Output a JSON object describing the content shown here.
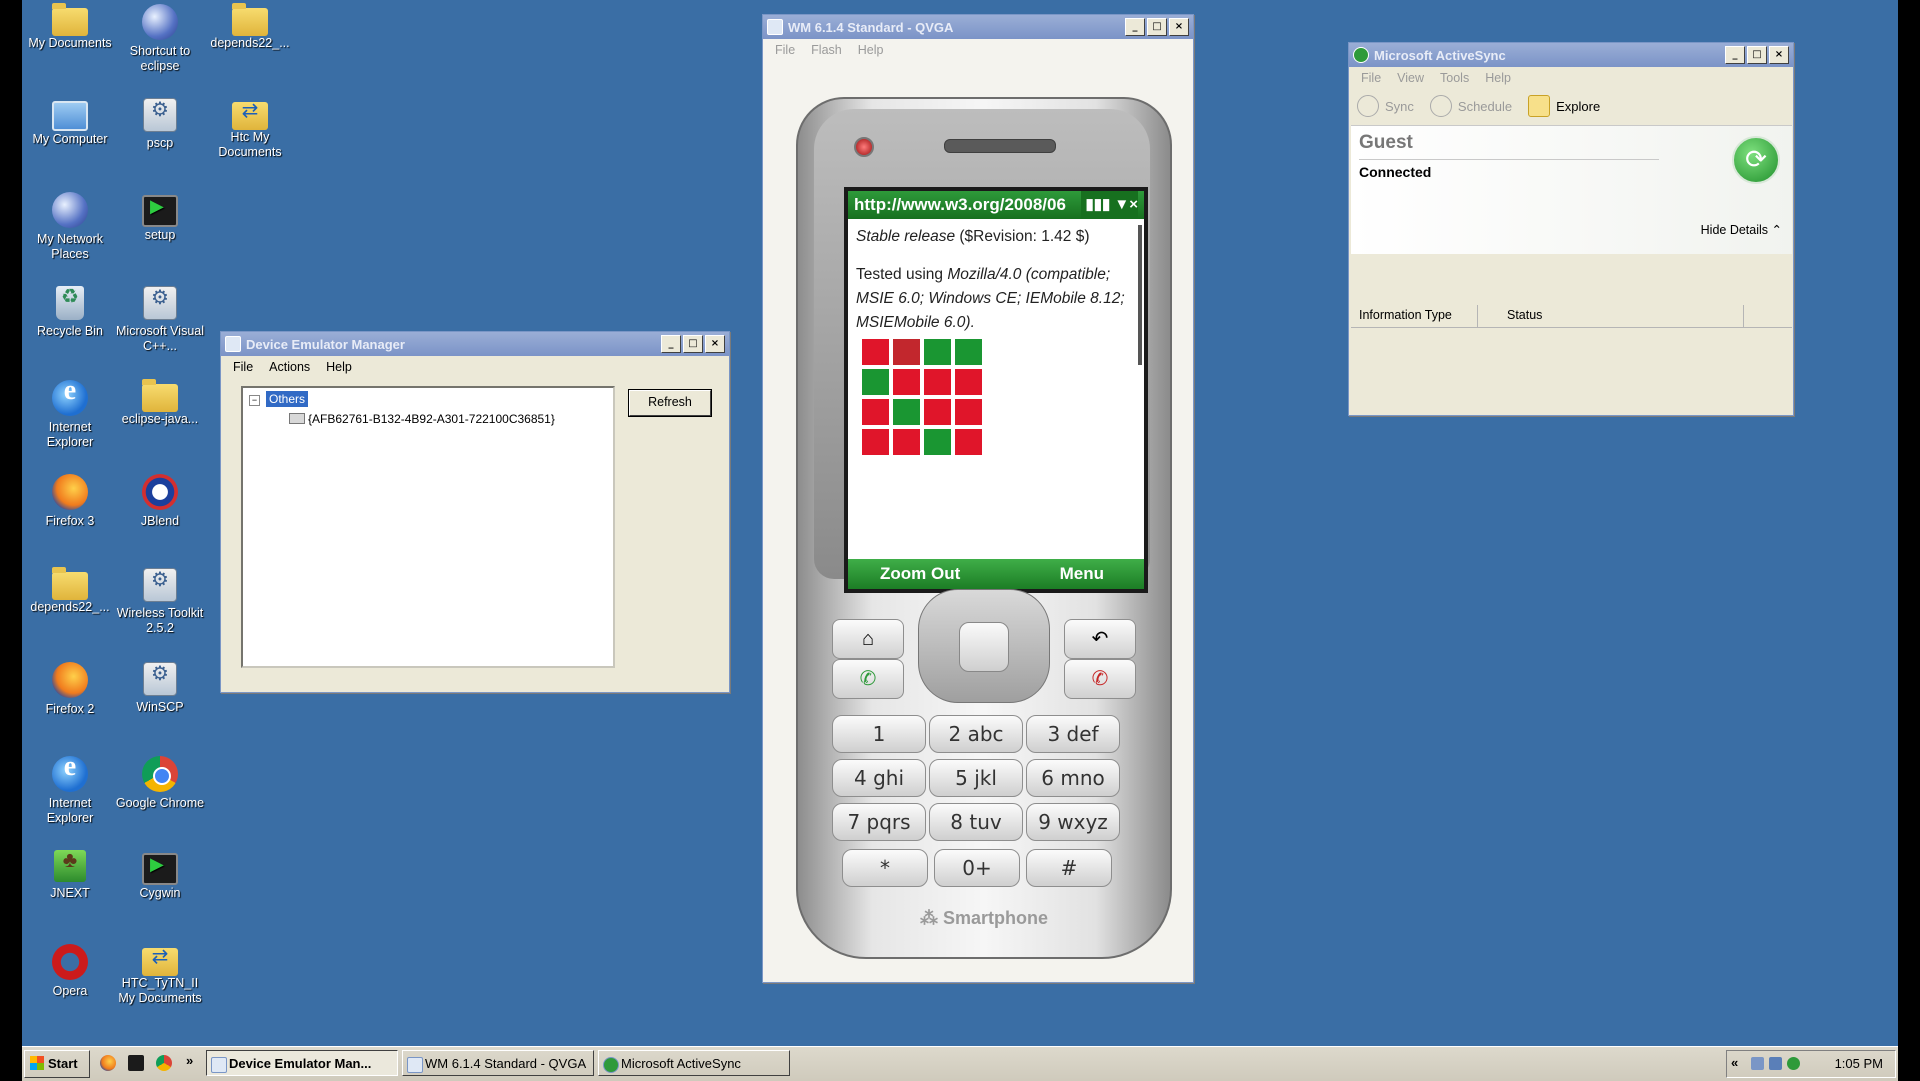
{
  "desktop_icons": [
    {
      "label": "My Documents",
      "icon": "folder-documents-icon"
    },
    {
      "label": "Shortcut to eclipse",
      "icon": "eclipse-icon"
    },
    {
      "label": "depends22_...",
      "icon": "folder-icon"
    },
    {
      "label": "My Computer",
      "icon": "my-computer-icon"
    },
    {
      "label": "pscp",
      "icon": "pscp-icon"
    },
    {
      "label": "Htc My Documents",
      "icon": "htc-sync-folder-icon"
    },
    {
      "label": "My Network Places",
      "icon": "network-places-icon"
    },
    {
      "label": "setup",
      "icon": "setup-icon"
    },
    {
      "label": "Recycle Bin",
      "icon": "recycle-bin-icon"
    },
    {
      "label": "Microsoft Visual C++...",
      "icon": "visual-cpp-icon"
    },
    {
      "label": "Internet Explorer",
      "icon": "internet-explorer-icon"
    },
    {
      "label": "eclipse-java...",
      "icon": "folder-icon"
    },
    {
      "label": "Firefox 3",
      "icon": "firefox-icon"
    },
    {
      "label": "JBlend",
      "icon": "jblend-icon"
    },
    {
      "label": "depends22_...",
      "icon": "folder-icon"
    },
    {
      "label": "Wireless Toolkit 2.5.2",
      "icon": "wireless-toolkit-icon"
    },
    {
      "label": "Firefox 2",
      "icon": "firefox-icon"
    },
    {
      "label": "WinSCP",
      "icon": "winscp-icon"
    },
    {
      "label": "Internet Explorer",
      "icon": "internet-explorer-icon"
    },
    {
      "label": "Google Chrome",
      "icon": "chrome-icon"
    },
    {
      "label": "JNEXT",
      "icon": "jnext-icon"
    },
    {
      "label": "Cygwin",
      "icon": "cygwin-icon"
    },
    {
      "label": "Opera",
      "icon": "opera-icon"
    },
    {
      "label": "HTC_TyTN_II My Documents",
      "icon": "htc-sync-folder-icon"
    }
  ],
  "dem": {
    "title": "Device Emulator Manager",
    "menu": [
      "File",
      "Actions",
      "Help"
    ],
    "tree_root": "Others",
    "tree_child": "{AFB62761-B132-4B92-A301-722100C36851}",
    "refresh_label": "Refresh"
  },
  "emulator": {
    "title": "WM 6.1.4 Standard - QVGA",
    "menu": [
      "File",
      "Flash",
      "Help"
    ],
    "url": "http://www.w3.org/2008/06",
    "content": {
      "line1_italic": "Stable release",
      "line1_rest": " ($Revision: 1.42 $)",
      "tested_prefix": "Tested using ",
      "tested_ua": "Mozilla/4.0 (compatible; MSIE 6.0; Windows CE; IEMobile 8.12; MSIEMobile 6.0)."
    },
    "grid_colors": [
      [
        "#e0152a",
        "#c2272d",
        "#1a9632",
        "#1a9632"
      ],
      [
        "#1a9632",
        "#e0152a",
        "#e0152a",
        "#e0152a"
      ],
      [
        "#e0152a",
        "#1a9632",
        "#e0152a",
        "#e0152a"
      ],
      [
        "#e0152a",
        "#e0152a",
        "#1a9632",
        "#e0152a"
      ]
    ],
    "softkey_left": "Zoom Out",
    "softkey_right": "Menu",
    "keys": [
      "1",
      "2 abc",
      "3 def",
      "4 ghi",
      "5 jkl",
      "6 mno",
      "7 pqrs",
      "8 tuv",
      "9 wxyz",
      "*",
      "0+",
      "#"
    ],
    "brand": "Smartphone"
  },
  "activesync": {
    "title": "Microsoft ActiveSync",
    "menu": [
      "File",
      "View",
      "Tools",
      "Help"
    ],
    "toolbar": {
      "sync": "Sync",
      "schedule": "Schedule",
      "explore": "Explore"
    },
    "partner": "Guest",
    "status": "Connected",
    "hide_details": "Hide Details",
    "col_info_type": "Information Type",
    "col_status": "Status"
  },
  "taskbar": {
    "start": "Start",
    "overflow": "»",
    "buttons": [
      "Device Emulator Man...",
      "WM 6.1.4 Standard - QVGA",
      "Microsoft ActiveSync"
    ],
    "clock": "1:05 PM",
    "tray_expand": "«"
  }
}
